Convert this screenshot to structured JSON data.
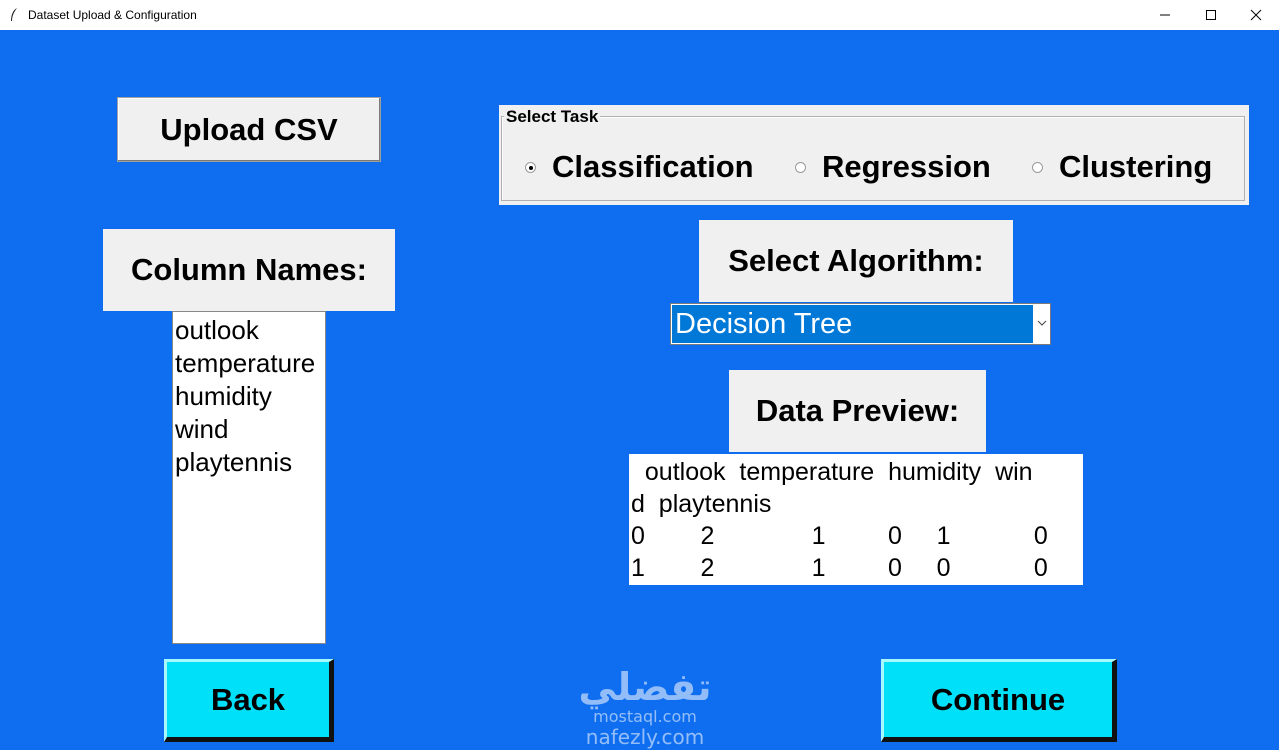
{
  "window": {
    "title": "Dataset Upload & Configuration",
    "controls": [
      "minimize-icon",
      "maximize-icon",
      "close-icon"
    ]
  },
  "upload_button": "Upload CSV",
  "column_names": {
    "label": "Column Names:",
    "items": [
      "outlook",
      "temperature",
      "humidity",
      "wind",
      "playtennis"
    ]
  },
  "task": {
    "legend": "Select Task",
    "options": [
      "Classification",
      "Regression",
      "Clustering"
    ],
    "selected": "Classification"
  },
  "algorithm": {
    "label": "Select Algorithm:",
    "selected": "Decision Tree"
  },
  "preview": {
    "label": "Data Preview:",
    "lines": [
      "  outlook  temperature  humidity  win",
      "d  playtennis",
      "0        2              1         0     1            0",
      "1        2              1         0     0            0"
    ]
  },
  "back_button": "Back",
  "continue_button": "Continue",
  "watermark": {
    "line1": "تفضلي",
    "line2": "mostaql.com",
    "line3": "nafezly.com"
  },
  "colors": {
    "background": "#0f6ef0",
    "nav_button": "#00e0f8",
    "combo_highlight": "#0078d7"
  }
}
